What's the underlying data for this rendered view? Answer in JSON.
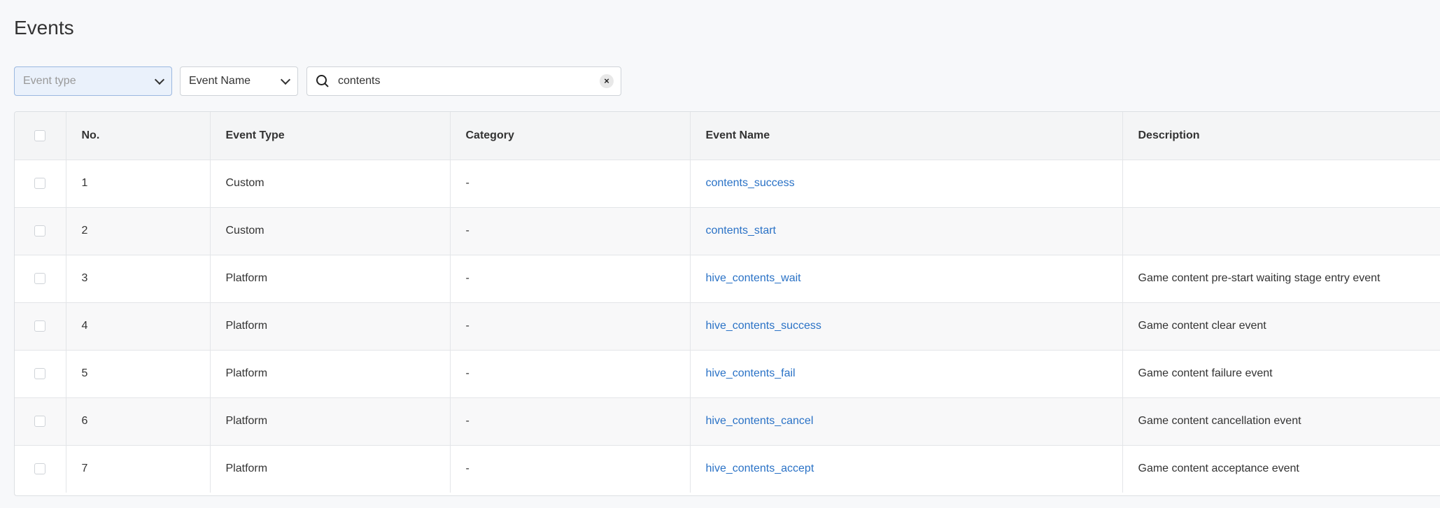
{
  "page": {
    "title": "Events"
  },
  "filters": {
    "event_type_placeholder": "Event type",
    "event_name_label": "Event Name",
    "search_value": "contents",
    "clear_symbol": "×"
  },
  "table": {
    "columns": [
      "No.",
      "Event Type",
      "Category",
      "Event Name",
      "Description"
    ],
    "rows": [
      {
        "no": "1",
        "type": "Custom",
        "category": "-",
        "name": "contents_success",
        "description": ""
      },
      {
        "no": "2",
        "type": "Custom",
        "category": "-",
        "name": "contents_start",
        "description": ""
      },
      {
        "no": "3",
        "type": "Platform",
        "category": "-",
        "name": "hive_contents_wait",
        "description": "Game content pre-start waiting stage entry event"
      },
      {
        "no": "4",
        "type": "Platform",
        "category": "-",
        "name": "hive_contents_success",
        "description": "Game content clear event"
      },
      {
        "no": "5",
        "type": "Platform",
        "category": "-",
        "name": "hive_contents_fail",
        "description": "Game content failure event"
      },
      {
        "no": "6",
        "type": "Platform",
        "category": "-",
        "name": "hive_contents_cancel",
        "description": "Game content cancellation event"
      },
      {
        "no": "7",
        "type": "Platform",
        "category": "-",
        "name": "hive_contents_accept",
        "description": "Game content acceptance event"
      }
    ]
  },
  "colors": {
    "link": "#2a72c6",
    "background": "#f7f8fa",
    "selected_filter": "#eaf1fb"
  }
}
